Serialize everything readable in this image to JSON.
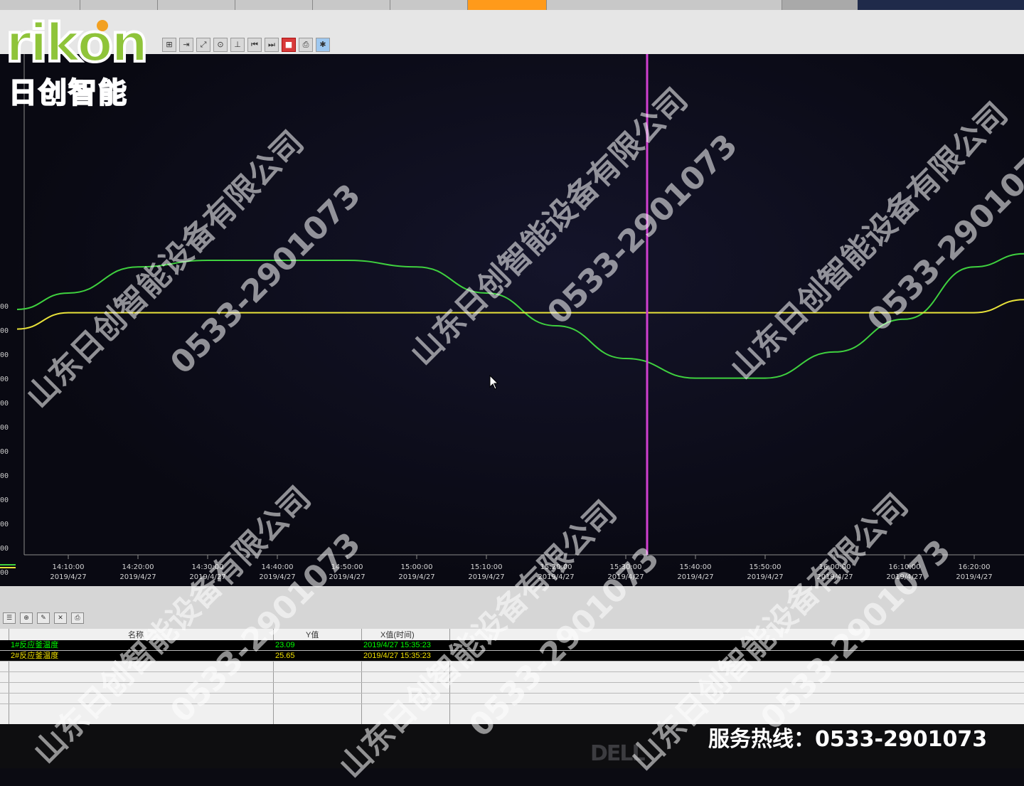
{
  "app": {
    "top_tabs": [
      "",
      "",
      "",
      "",
      "",
      "",
      "",
      "",
      ""
    ]
  },
  "toolbar": {
    "icons": [
      "zoom-in-icon",
      "zoom-out-icon",
      "fit-icon",
      "cursor-icon",
      "measure-icon",
      "rewind-icon",
      "forward-icon",
      "stop-icon",
      "print-icon",
      "settings-icon"
    ]
  },
  "chart_data": {
    "type": "line",
    "x": [
      "14:10:00",
      "14:20:00",
      "14:30:00",
      "14:40:00",
      "14:50:00",
      "15:00:00",
      "15:10:00",
      "15:20:00",
      "15:30:00",
      "15:40:00",
      "15:50:00",
      "16:00:00",
      "16:10:00",
      "16:20:00"
    ],
    "x_dates": [
      "2019/4/27",
      "2019/4/27",
      "2019/4/27",
      "2019/4/27",
      "2019/4/27",
      "2019/4/27",
      "2019/4/27",
      "2019/4/27",
      "2019/4/27",
      "2019/4/27",
      "2019/4/27",
      "2019/4/27",
      "2019/4/27",
      "2019/4/27"
    ],
    "y_tick_labels": [
      "00",
      "00",
      "00",
      "00",
      "00",
      "00",
      "00",
      "00",
      "00",
      "00",
      "00",
      "00",
      ".00"
    ],
    "series": [
      {
        "name": "1#反应釜温度",
        "color": "#3fd13f",
        "values": [
          24.0,
          24.4,
          24.5,
          24.5,
          24.5,
          24.4,
          24.0,
          23.5,
          23.0,
          22.7,
          22.7,
          23.1,
          23.6,
          24.4
        ]
      },
      {
        "name": "2#反应釜温度",
        "color": "#e8e23a",
        "values": [
          23.7,
          23.7,
          23.7,
          23.7,
          23.7,
          23.7,
          23.7,
          23.7,
          23.7,
          23.7,
          23.7,
          23.7,
          23.7,
          23.7
        ]
      }
    ],
    "cursor_x": "15:30:00",
    "cursor_color": "#d040d0",
    "grid": false
  },
  "legend_panel": {
    "headers": {
      "name": "名称",
      "y": "Y值",
      "x": "X值(时间)"
    },
    "rows": [
      {
        "name": "1#反应釜温度",
        "y": "23.09",
        "x": "2019/4/27 15:35:23",
        "color": "#00ff00"
      },
      {
        "name": "2#反应釜温度",
        "y": "25.65",
        "x": "2019/4/27 15:35:23",
        "color": "#f0e000"
      }
    ]
  },
  "branding": {
    "logo_word": "rikon",
    "logo_cn": "日创智能",
    "watermark_company": "山东日创智能设备有限公司",
    "watermark_phone": "0533-2901073",
    "hotline": "服务热线：0533-2901073",
    "monitor_brand": "DELL"
  }
}
